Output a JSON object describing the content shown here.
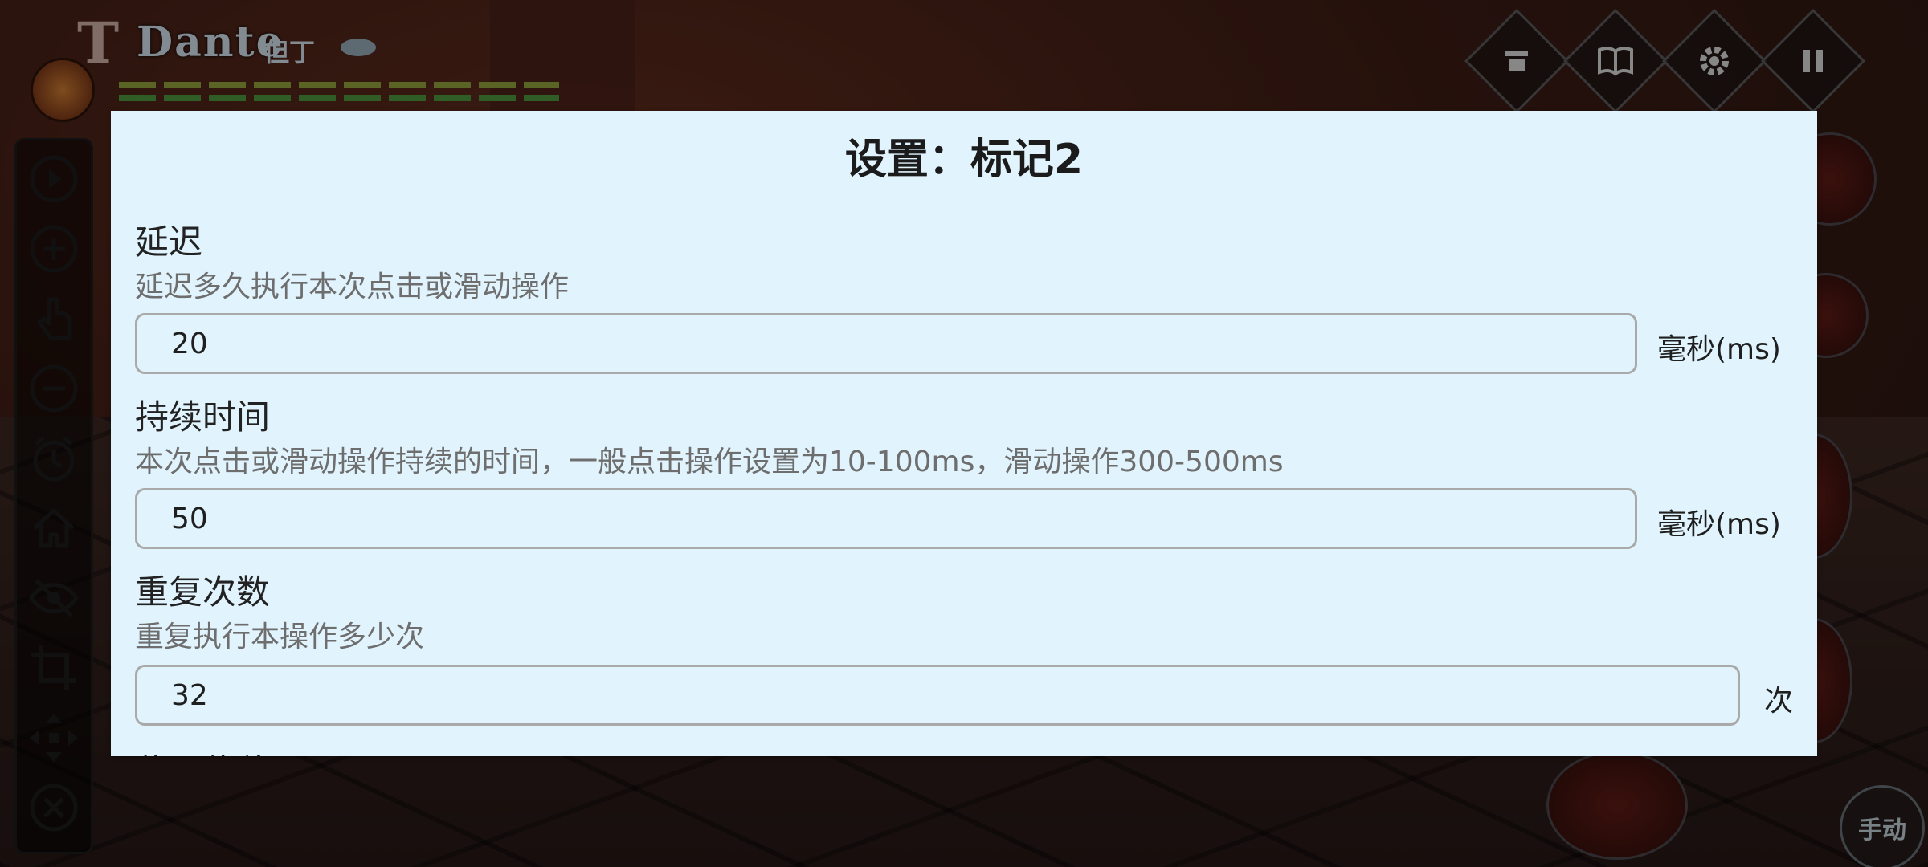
{
  "hud": {
    "rank_glyph": "T",
    "name": "Dante",
    "name_cn": "但丁"
  },
  "dialog": {
    "title": "设置：标记2",
    "delay": {
      "title": "延迟",
      "description": "延迟多久执行本次点击或滑动操作",
      "value": "20",
      "unit": "毫秒(ms)"
    },
    "duration": {
      "title": "持续时间",
      "description": "本次点击或滑动操作持续的时间，一般点击操作设置为10-100ms，滑动操作300-500ms",
      "value": "50",
      "unit": "毫秒(ms)"
    },
    "repeat": {
      "title": "重复次数",
      "description": "重复执行本操作多少次",
      "value": "32",
      "unit": "次"
    },
    "offset": {
      "title": "位置偏移"
    }
  },
  "game": {
    "manual_label": "手动"
  },
  "toolbar": {
    "icons": [
      "play-icon",
      "add-icon",
      "tap-icon",
      "remove-icon",
      "alarm-icon",
      "home-icon",
      "hide-icon",
      "crop-icon",
      "move-icon",
      "close-icon"
    ]
  },
  "top_buttons": {
    "icons": [
      "skill-icon",
      "book-icon",
      "gear-icon",
      "pause-icon"
    ]
  },
  "colors": {
    "dialog_bg": "#e1f4fd",
    "field_border": "#a9a9a9",
    "description_text": "#6e6e6e"
  }
}
